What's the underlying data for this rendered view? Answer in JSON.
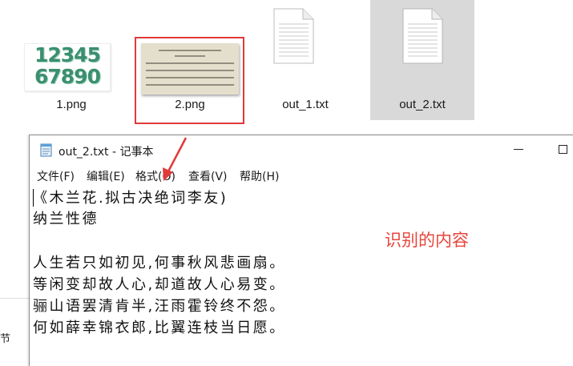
{
  "files": [
    {
      "name": "1.png",
      "thumb_text": [
        "12345",
        "67890"
      ],
      "selected": false
    },
    {
      "name": "2.png",
      "selected": false,
      "highlighted": true
    },
    {
      "name": "out_1.txt",
      "selected": false
    },
    {
      "name": "out_2.txt",
      "selected": true
    }
  ],
  "notepad": {
    "title": "out_2.txt - 记事本",
    "menu": [
      "文件(F)",
      "编辑(E)",
      "格式(O)",
      "查看(V)",
      "帮助(H)"
    ],
    "lines": [
      "《木兰花.拟古决绝词李友)",
      "纳兰性德",
      "",
      "人生若只如初见,何事秋风悲画扇。",
      "等闲变却故人心,却道故人心易变。",
      "骊山语罢清肯半,汪雨霍铃终不怨。",
      "何如薛幸锦衣郎,比翼连枝当日愿。"
    ]
  },
  "annotation": "识别的内容",
  "sidebar_partial_text": "节",
  "colors": {
    "highlight": "#e03a3a",
    "annotation": "#e8453c",
    "selected_bg": "#d9d9d9",
    "digits": "#3b8f6e"
  }
}
